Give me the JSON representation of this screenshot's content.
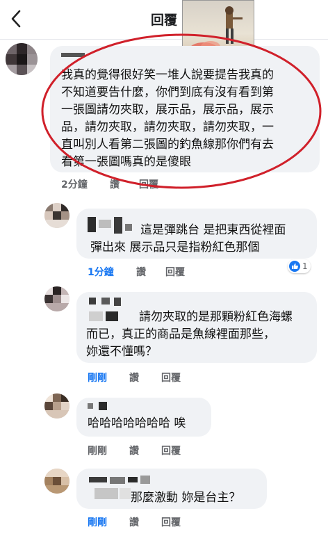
{
  "header": {
    "title": "回覆"
  },
  "comments": [
    {
      "text_lines": [
        "我真的覺得很好笑一堆人說要提告我真的",
        "不知道要告什麼，你們到底有沒有看到第",
        "一張圖請勿夾取，展示品，展示品，展示",
        "品，請勿夾取，請勿夾取，請勿夾取，一",
        "直叫別人看第二張圖的釣魚線那你們有去",
        "看第一張圖嗎真的是傻眼"
      ],
      "time": "2分鐘",
      "like": "讚",
      "reply": "回覆"
    }
  ],
  "replies": [
    {
      "text_lines": [
        "這是彈跳台 是把東西從裡面",
        "彈出來 展示品只是指粉紅色那個"
      ],
      "time": "1分鐘",
      "like": "讚",
      "reply": "回覆",
      "reactions": "1"
    },
    {
      "text_lines": [
        "請勿夾取的是那顆粉紅色海螺",
        "而已，真正的商品是魚線裡面那些，",
        "妳還不懂嗎？"
      ],
      "time": "剛剛",
      "like": "讚",
      "reply": "回覆"
    },
    {
      "text_lines": [
        "哈哈哈哈哈哈哈 唉"
      ],
      "time": "剛剛",
      "like": "讚",
      "reply": "回覆"
    },
    {
      "text_lines": [
        "那麼激動 妳是台主？"
      ],
      "time": "剛剛",
      "like": "讚",
      "reply": "回覆"
    }
  ],
  "colors": {
    "accent": "#1877f2",
    "bubble": "#f0f2f5",
    "annotation_circle": "#d0202a"
  },
  "icons": [
    "back-arrow-icon",
    "like-reaction-icon"
  ]
}
